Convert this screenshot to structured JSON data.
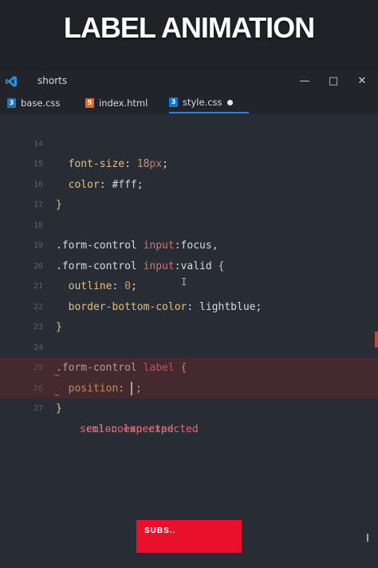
{
  "banner": {
    "title": "LABEL ANIMATION"
  },
  "window": {
    "title": "shorts",
    "controls": {
      "minimize": "—",
      "maximize": "□",
      "close": "✕"
    }
  },
  "tabs": [
    {
      "label": "base.css",
      "icon": "css-file-icon",
      "active": false
    },
    {
      "label": "index.html",
      "icon": "html-file-icon",
      "active": false
    },
    {
      "label": "style.css",
      "icon": "css-file-icon",
      "active": true,
      "modified": true
    }
  ],
  "editor": {
    "lines": [
      {
        "n": "14",
        "text": "  font-size: 18px;"
      },
      {
        "n": "15",
        "text": "  color: #fff;"
      },
      {
        "n": "16",
        "text": "}"
      },
      {
        "n": "17",
        "text": ""
      },
      {
        "n": "18",
        "text": ".form-control input:focus,"
      },
      {
        "n": "19",
        "text": ".form-control input:valid {"
      },
      {
        "n": "20",
        "text": "  outline: 0;"
      },
      {
        "n": "21",
        "text": "  border-bottom-color: lightblue;"
      },
      {
        "n": "22",
        "text": "}"
      },
      {
        "n": "23",
        "text": ""
      },
      {
        "n": "24",
        "text": ".form-control label {"
      },
      {
        "n": "25",
        "text": "  position: ;"
      },
      {
        "n": "26",
        "text": "}"
      },
      {
        "n": "27",
        "text": ""
      }
    ],
    "errors": {
      "colon": "colon expected",
      "semicolon": "semi-colon expected"
    }
  },
  "overlay": {
    "subscribe": "SUBS.."
  },
  "colors": {
    "accent": "#3a7fd1",
    "error": "#e06c75",
    "subscribe": "#e8102a"
  }
}
